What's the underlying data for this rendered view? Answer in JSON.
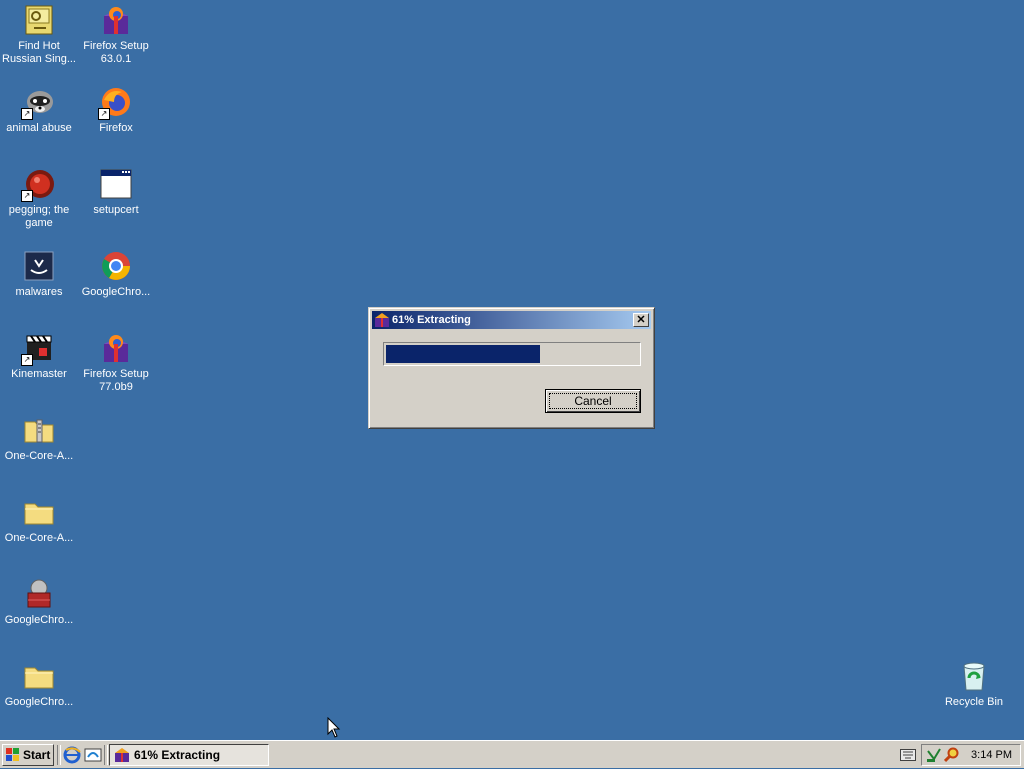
{
  "desktop": {
    "icons": [
      {
        "label": "Find Hot Russian Sing...",
        "icon": "certificate-icon"
      },
      {
        "label": "Firefox Setup 63.0.1",
        "icon": "firefox-setup-icon"
      },
      {
        "label": "animal abuse",
        "icon": "raccoon-icon"
      },
      {
        "label": "Firefox",
        "icon": "firefox-icon"
      },
      {
        "label": "pegging; the game",
        "icon": "red-ball-icon"
      },
      {
        "label": "setupcert",
        "icon": "window-icon"
      },
      {
        "label": "malwares",
        "icon": "app-icon"
      },
      {
        "label": "GoogleChro...",
        "icon": "chrome-icon"
      },
      {
        "label": "Kinemaster",
        "icon": "clapper-icon"
      },
      {
        "label": "Firefox Setup 77.0b9",
        "icon": "firefox-setup-icon"
      },
      {
        "label": "One-Core-A...",
        "icon": "zip-folder-icon"
      },
      {
        "label": "One-Core-A...",
        "icon": "folder-icon"
      },
      {
        "label": "GoogleChro...",
        "icon": "installer-icon"
      },
      {
        "label": "GoogleChro...",
        "icon": "folder-icon"
      },
      {
        "label": "Recycle Bin",
        "icon": "recycle-bin-icon"
      }
    ]
  },
  "dialog": {
    "title": "61% Extracting",
    "progress": 0.61,
    "close_glyph": "✕",
    "cancel_label": "Cancel"
  },
  "taskbar": {
    "start_label": "Start",
    "task_label": "61% Extracting",
    "clock": "3:14 PM"
  },
  "colors": {
    "desktop": "#3a6ea5",
    "title_active": "#0a246a",
    "progress_fill": "#0a246a",
    "chrome": "#d4d0c8"
  }
}
